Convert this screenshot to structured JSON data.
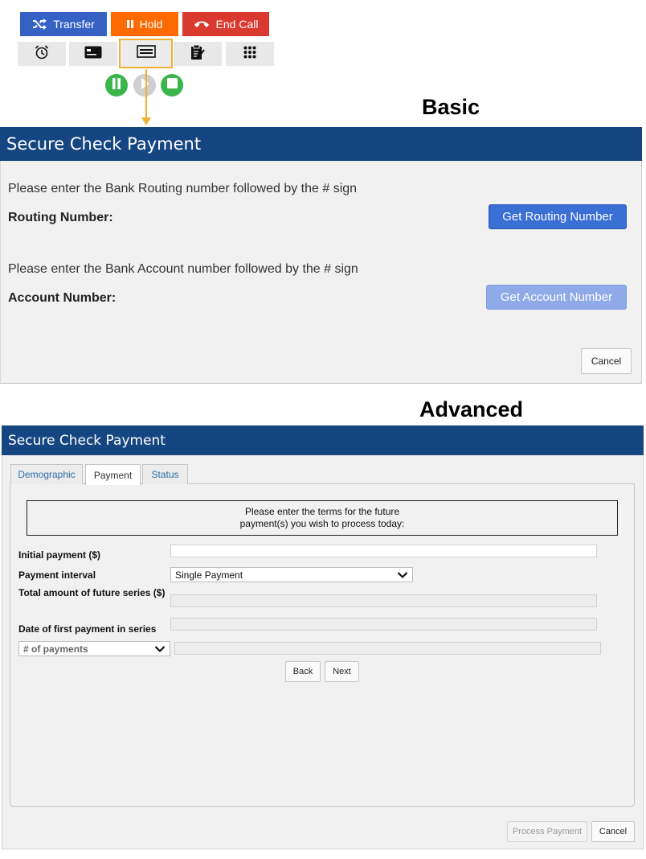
{
  "call_toolbar": {
    "transfer_label": "Transfer",
    "hold_label": "Hold",
    "end_call_label": "End Call",
    "transfer_color": "#3561c4",
    "hold_color": "#ff6a00",
    "end_call_color": "#d9392f"
  },
  "tools": [
    {
      "icon": "alarm-clock-icon"
    },
    {
      "icon": "credit-card-icon"
    },
    {
      "icon": "check-payment-icon",
      "active": true
    },
    {
      "icon": "clipboard-sign-icon"
    },
    {
      "icon": "keypad-icon"
    }
  ],
  "recording_controls": [
    {
      "icon": "pause-icon",
      "color": "#3ab54a"
    },
    {
      "icon": "play-icon",
      "color": "#cfcfcf"
    },
    {
      "icon": "stop-icon",
      "color": "#3ab54a"
    }
  ],
  "captions": {
    "basic": "Basic",
    "advanced": "Advanced"
  },
  "basic_panel": {
    "title": "Secure Check Payment",
    "routing_instruction": "Please enter the Bank Routing number followed by the # sign",
    "routing_label": "Routing Number:",
    "routing_button": "Get Routing Number",
    "account_instruction": "Please enter the Bank Account number followed by the # sign",
    "account_label": "Account Number:",
    "account_button": "Get Account Number",
    "cancel_label": "Cancel"
  },
  "advanced_panel": {
    "title": "Secure Check Payment",
    "tabs": [
      {
        "label": "Demographic",
        "active": false
      },
      {
        "label": "Payment",
        "active": true
      },
      {
        "label": "Status",
        "active": false
      }
    ],
    "message_line1": "Please enter the terms for the future",
    "message_line2": "payment(s) you wish to process today:",
    "fields": {
      "initial_payment_label": "Initial payment ($)",
      "initial_payment_value": "",
      "payment_interval_label": "Payment interval",
      "payment_interval_value": "Single Payment",
      "total_amount_label": "Total amount of future series ($)",
      "total_amount_value": "",
      "first_date_label": "Date of first payment in series",
      "first_date_value": "",
      "num_payments_select": "# of payments",
      "num_payments_value": ""
    },
    "back_label": "Back",
    "next_label": "Next",
    "process_payment_label": "Process Payment",
    "cancel_label": "Cancel"
  },
  "colors": {
    "header_blue": "#154681",
    "arrow_orange": "#f2b134",
    "primary_button": "#3a6fd6",
    "disabled_button": "#8eaae8"
  }
}
